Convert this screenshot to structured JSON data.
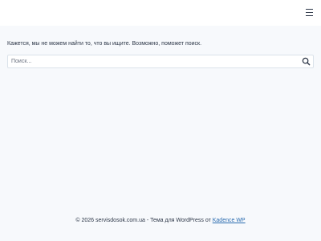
{
  "header": {
    "menu_icon": "hamburger-menu-icon"
  },
  "main": {
    "message": "Кажется, мы не можем найти то, что вы ищите. Возможно, поможет поиск.",
    "search": {
      "placeholder": "Поиск...",
      "value": "",
      "button_icon": "search-icon"
    }
  },
  "footer": {
    "copyright": "© 2026 servisdosok.com.ua - Тема для WordPress от ",
    "link_text": "Kadence WP"
  },
  "colors": {
    "background": "#f7f9fc",
    "header_bg": "#ffffff",
    "text": "#2d3748",
    "link": "#2b6cb0"
  }
}
